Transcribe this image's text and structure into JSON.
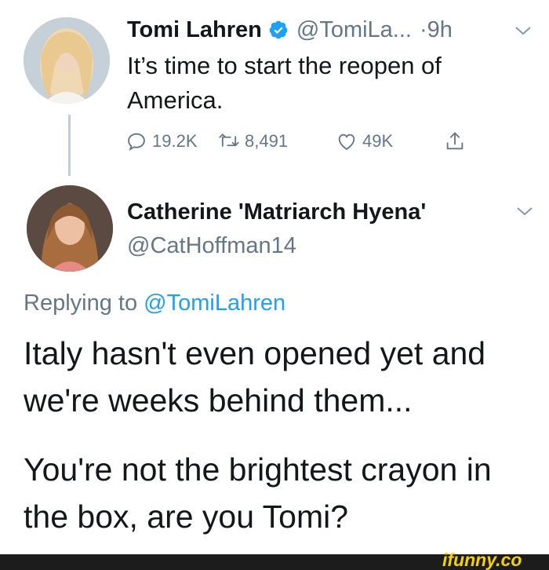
{
  "original_tweet": {
    "name": "Tomi Lahren",
    "handle": "@TomiLa...",
    "separator": "·",
    "time": "9h",
    "text": "It’s time to start the reopen of America.",
    "stats": {
      "replies": "19.2K",
      "retweets": "8,491",
      "likes": "49K"
    }
  },
  "reply_tweet": {
    "name": "Catherine 'Matriarch Hyena'",
    "handle": "@CatHoffman14",
    "replying_prefix": "Replying to",
    "replying_mention": "@TomiLahren",
    "paragraphs": [
      "Italy hasn't even opened yet and we're weeks behind them...",
      "You're not the brightest crayon in the box, are you Tomi?"
    ]
  },
  "watermark": {
    "text": "ifunny.co"
  },
  "colors": {
    "text_primary": "#14171a",
    "text_secondary": "#657786",
    "link": "#1da1f2",
    "verified": "#1da1f2",
    "watermark": "#f5d200"
  },
  "icons": [
    "verified-badge-icon",
    "chevron-down-icon",
    "reply-icon",
    "retweet-icon",
    "like-icon",
    "share-icon"
  ]
}
